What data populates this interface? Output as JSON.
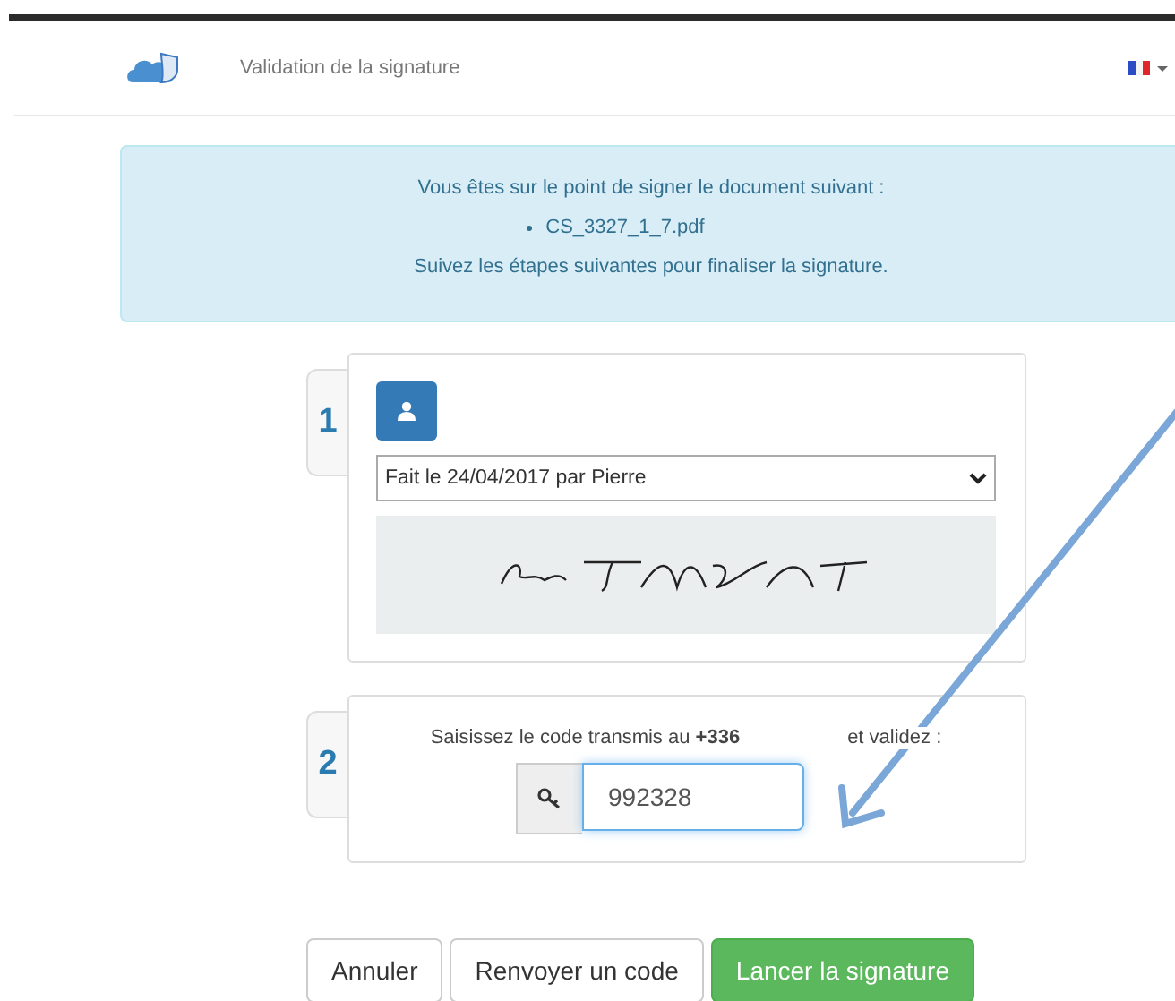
{
  "header": {
    "title": "Validation de la signature"
  },
  "notice": {
    "intro": "Vous êtes sur le point de signer le document suivant :",
    "documents": [
      "CS_3327_1_7.pdf"
    ],
    "outro": "Suivez les étapes suivantes pour finaliser la signature."
  },
  "steps": [
    {
      "number": "1",
      "kind": "signature",
      "select_value": "Fait le 24/04/2017 par Pierre"
    },
    {
      "number": "2",
      "kind": "code",
      "prompt": "Saisissez le code transmis au **+336**",
      "prompt_end": "et validez :",
      "code_value": "992328"
    }
  ],
  "buttons": [
    {
      "label": "Annuler",
      "kind": "default"
    },
    {
      "label": "Renvoyer un code",
      "kind": "default"
    },
    {
      "label": "Lancer la signature",
      "kind": "primary"
    }
  ]
}
